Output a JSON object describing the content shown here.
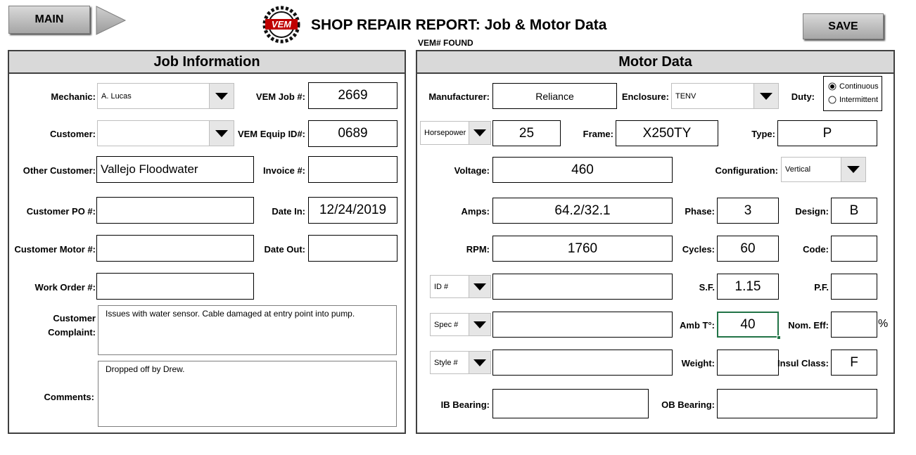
{
  "header": {
    "main_label": "MAIN",
    "title": "SHOP REPAIR REPORT: Job & Motor Data",
    "status": "VEM# FOUND",
    "save_label": "SAVE",
    "logo_text": "VEM"
  },
  "job": {
    "title": "Job Information",
    "mechanic_label": "Mechanic:",
    "mechanic_value": "A. Lucas",
    "customer_label": "Customer:",
    "customer_value": "",
    "other_customer_label": "Other Customer:",
    "other_customer_value": "Vallejo Floodwater",
    "customer_po_label": "Customer PO #:",
    "customer_po_value": "",
    "customer_motor_label": "Customer Motor #:",
    "customer_motor_value": "",
    "work_order_label": "Work Order #:",
    "work_order_value": "",
    "vem_job_label": "VEM Job #:",
    "vem_job_value": "2669",
    "vem_equip_label": "VEM Equip ID#:",
    "vem_equip_value": "0689",
    "invoice_label": "Invoice #:",
    "invoice_value": "",
    "date_in_label": "Date In:",
    "date_in_value": "12/24/2019",
    "date_out_label": "Date Out:",
    "date_out_value": "",
    "complaint_label_1": "Customer",
    "complaint_label_2": "Complaint:",
    "complaint_value": "Issues with water sensor. Cable damaged at entry point into pump.",
    "comments_label": "Comments:",
    "comments_value": "Dropped off by Drew."
  },
  "motor": {
    "title": "Motor Data",
    "manufacturer_label": "Manufacturer:",
    "manufacturer_value": "Reliance",
    "enclosure_label": "Enclosure:",
    "enclosure_value": "TENV",
    "duty_label": "Duty:",
    "duty_options": [
      "Continuous",
      "Intermittent"
    ],
    "duty_selected": "Continuous",
    "power_unit": "Horsepower",
    "power_value": "25",
    "frame_label": "Frame:",
    "frame_value": "X250TY",
    "type_label": "Type:",
    "type_value": "P",
    "voltage_label": "Voltage:",
    "voltage_value": "460",
    "configuration_label": "Configuration:",
    "configuration_value": "Vertical",
    "amps_label": "Amps:",
    "amps_value": "64.2/32.1",
    "phase_label": "Phase:",
    "phase_value": "3",
    "design_label": "Design:",
    "design_value": "B",
    "rpm_label": "RPM:",
    "rpm_value": "1760",
    "cycles_label": "Cycles:",
    "cycles_value": "60",
    "code_label": "Code:",
    "code_value": "",
    "id_select": "ID #",
    "id_value": "",
    "sf_label": "S.F.",
    "sf_value": "1.15",
    "pf_label": "P.F.",
    "pf_value": "",
    "spec_select": "Spec #",
    "spec_value": "",
    "amb_label": "Amb T°:",
    "amb_value": "40",
    "nom_eff_label": "Nom. Eff:",
    "nom_eff_value": "",
    "percent": "%",
    "style_select": "Style #",
    "style_value": "",
    "weight_label": "Weight:",
    "weight_value": "",
    "insul_label": "Insul Class:",
    "insul_value": "F",
    "ib_label": "IB Bearing:",
    "ib_value": "",
    "ob_label": "OB Bearing:",
    "ob_value": ""
  }
}
